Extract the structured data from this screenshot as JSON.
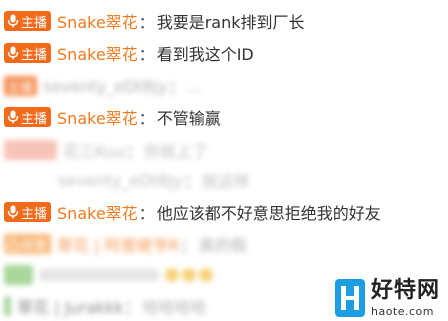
{
  "colors": {
    "host_badge": "#f26a1a",
    "room_badge": "#f5a04a",
    "username": "#f07a1e",
    "message": "#333333",
    "watermark_blue": "#1e9ee2"
  },
  "icons": {
    "host_badge_icon": "microphone-icon",
    "room_badge_icon": "house-icon"
  },
  "chat": {
    "messages": [
      {
        "badge": "主播",
        "user": "Snake翠花",
        "colon": "：",
        "text": "我要是rank排到厂长"
      },
      {
        "badge": "主播",
        "user": "Snake翠花",
        "colon": "：",
        "text": "看到我这个ID"
      },
      {
        "badge": "主播",
        "user": "seventy_eDtBjy",
        "colon": "：",
        "text": "...",
        "blurred": true
      },
      {
        "badge": "主播",
        "user": "Snake翠花",
        "colon": "：",
        "text": "不管输赢"
      },
      {
        "badge": "",
        "user": "花三Kuu",
        "colon": "：",
        "text": "你就上了",
        "blurred": true
      },
      {
        "badge": "",
        "user": "seventy_eDtBjy",
        "colon": "：",
        "text": "就这样",
        "blurred": true
      },
      {
        "badge": "主播",
        "user": "Snake翠花",
        "colon": "：",
        "text": "他应该都不好意思拒绝我的好友"
      },
      {
        "badge": "房管",
        "user": "翠花 | 阿曾姥爷R",
        "colon": "：",
        "text": "真的假",
        "blurred": true
      },
      {
        "badge": "",
        "user": "",
        "colon": "",
        "text": "",
        "blurred": true
      },
      {
        "badge": "",
        "user": "翠花 | Jurakkk",
        "colon": "：",
        "text": "哈哈哈哈",
        "blurred": true
      }
    ]
  },
  "watermark": {
    "title": "好特网",
    "url": "haote.com",
    "logo_letter": "H"
  }
}
